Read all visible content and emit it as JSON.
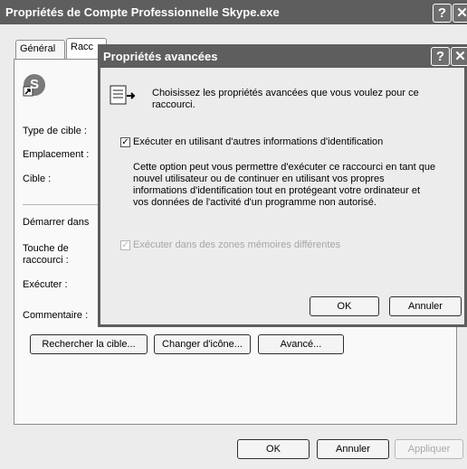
{
  "main_window": {
    "title": "Propriétés de Compte Professionnelle Skype.exe",
    "help_glyph": "?",
    "close_glyph": "✕",
    "tabs": [
      {
        "label": "Général"
      },
      {
        "label": "Racc"
      }
    ],
    "app_icon_label": "S",
    "fields": {
      "type_cible": "Type de cible :",
      "emplacement": "Emplacement :",
      "cible": "Cible :",
      "demarrer": "Démarrer dans",
      "touche": "Touche de raccourci :",
      "executer": "Exécuter :",
      "commentaire": "Commentaire :"
    },
    "buttons": {
      "rechercher": "Rechercher la cible...",
      "changer_icone": "Changer d'icône...",
      "avance": "Avancé...",
      "ok": "OK",
      "annuler": "Annuler",
      "appliquer": "Appliquer"
    }
  },
  "dialog": {
    "title": "Propriétés avancées",
    "help_glyph": "?",
    "close_glyph": "✕",
    "intro": "Choisissez les propriétés avancées que vous voulez pour ce raccourci.",
    "checkbox_credentials": {
      "label": "Exécuter en utilisant d'autres informations d'identification",
      "checked": true
    },
    "description": "Cette option peut vous permettre d'exécuter ce raccourci en tant que nouvel utilisateur ou de continuer en utilisant vos propres informations d'identification tout en protégeant votre ordinateur et vos données de l'activité d'un programme non autorisé.",
    "checkbox_memory": {
      "label": "Exécuter dans des zones mémoires différentes",
      "checked": true,
      "enabled": false
    },
    "ok_label": "OK",
    "cancel_label": "Annuler"
  },
  "colors": {
    "titlebar": "#5e5e5e",
    "panel": "#ececec",
    "background": "#6a6a6a"
  }
}
